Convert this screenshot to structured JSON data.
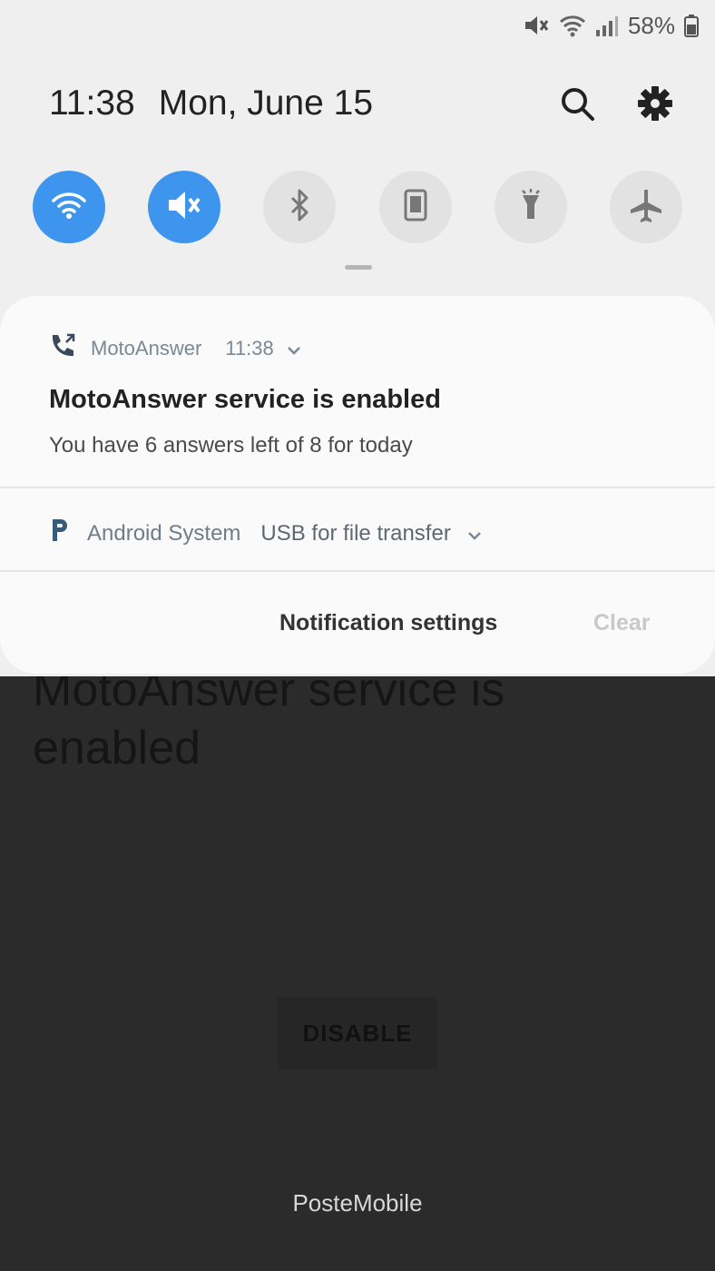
{
  "status_bar": {
    "battery": "58%",
    "icons": [
      "mute-icon",
      "wifi-icon",
      "signal-icon",
      "battery-icon"
    ]
  },
  "header": {
    "time": "11:38",
    "date": "Mon, June 15",
    "icons": [
      "search-icon",
      "settings-gear-icon"
    ]
  },
  "quick_tiles": [
    {
      "name": "wifi",
      "state": "on"
    },
    {
      "name": "sound-mute",
      "state": "on"
    },
    {
      "name": "bluetooth",
      "state": "off"
    },
    {
      "name": "auto-rotate",
      "state": "off"
    },
    {
      "name": "flashlight",
      "state": "off"
    },
    {
      "name": "airplane-mode",
      "state": "off"
    }
  ],
  "notifications": [
    {
      "app": "MotoAnswer",
      "time": "11:38",
      "title": "MotoAnswer service is enabled",
      "text": "You have 6 answers left of 8 for today"
    },
    {
      "app": "Android System",
      "text": "USB for file transfer"
    }
  ],
  "actions": {
    "settings_label": "Notification settings",
    "clear_label": "Clear"
  },
  "background_app": {
    "title": "MotoAnswer service is enabled",
    "button_label": "DISABLE",
    "carrier": "PosteMobile"
  },
  "colors": {
    "accent": "#3e95ed",
    "shade": "#efefef",
    "card": "#fafafa",
    "app_background": "#2b2b2b"
  }
}
